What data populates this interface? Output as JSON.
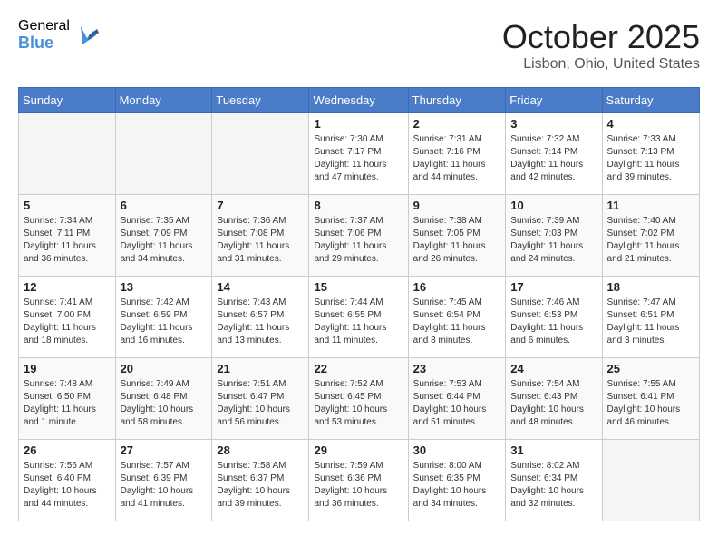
{
  "logo": {
    "general": "General",
    "blue": "Blue"
  },
  "title": "October 2025",
  "location": "Lisbon, Ohio, United States",
  "days_of_week": [
    "Sunday",
    "Monday",
    "Tuesday",
    "Wednesday",
    "Thursday",
    "Friday",
    "Saturday"
  ],
  "weeks": [
    [
      {
        "num": "",
        "info": ""
      },
      {
        "num": "",
        "info": ""
      },
      {
        "num": "",
        "info": ""
      },
      {
        "num": "1",
        "info": "Sunrise: 7:30 AM\nSunset: 7:17 PM\nDaylight: 11 hours\nand 47 minutes."
      },
      {
        "num": "2",
        "info": "Sunrise: 7:31 AM\nSunset: 7:16 PM\nDaylight: 11 hours\nand 44 minutes."
      },
      {
        "num": "3",
        "info": "Sunrise: 7:32 AM\nSunset: 7:14 PM\nDaylight: 11 hours\nand 42 minutes."
      },
      {
        "num": "4",
        "info": "Sunrise: 7:33 AM\nSunset: 7:13 PM\nDaylight: 11 hours\nand 39 minutes."
      }
    ],
    [
      {
        "num": "5",
        "info": "Sunrise: 7:34 AM\nSunset: 7:11 PM\nDaylight: 11 hours\nand 36 minutes."
      },
      {
        "num": "6",
        "info": "Sunrise: 7:35 AM\nSunset: 7:09 PM\nDaylight: 11 hours\nand 34 minutes."
      },
      {
        "num": "7",
        "info": "Sunrise: 7:36 AM\nSunset: 7:08 PM\nDaylight: 11 hours\nand 31 minutes."
      },
      {
        "num": "8",
        "info": "Sunrise: 7:37 AM\nSunset: 7:06 PM\nDaylight: 11 hours\nand 29 minutes."
      },
      {
        "num": "9",
        "info": "Sunrise: 7:38 AM\nSunset: 7:05 PM\nDaylight: 11 hours\nand 26 minutes."
      },
      {
        "num": "10",
        "info": "Sunrise: 7:39 AM\nSunset: 7:03 PM\nDaylight: 11 hours\nand 24 minutes."
      },
      {
        "num": "11",
        "info": "Sunrise: 7:40 AM\nSunset: 7:02 PM\nDaylight: 11 hours\nand 21 minutes."
      }
    ],
    [
      {
        "num": "12",
        "info": "Sunrise: 7:41 AM\nSunset: 7:00 PM\nDaylight: 11 hours\nand 18 minutes."
      },
      {
        "num": "13",
        "info": "Sunrise: 7:42 AM\nSunset: 6:59 PM\nDaylight: 11 hours\nand 16 minutes."
      },
      {
        "num": "14",
        "info": "Sunrise: 7:43 AM\nSunset: 6:57 PM\nDaylight: 11 hours\nand 13 minutes."
      },
      {
        "num": "15",
        "info": "Sunrise: 7:44 AM\nSunset: 6:55 PM\nDaylight: 11 hours\nand 11 minutes."
      },
      {
        "num": "16",
        "info": "Sunrise: 7:45 AM\nSunset: 6:54 PM\nDaylight: 11 hours\nand 8 minutes."
      },
      {
        "num": "17",
        "info": "Sunrise: 7:46 AM\nSunset: 6:53 PM\nDaylight: 11 hours\nand 6 minutes."
      },
      {
        "num": "18",
        "info": "Sunrise: 7:47 AM\nSunset: 6:51 PM\nDaylight: 11 hours\nand 3 minutes."
      }
    ],
    [
      {
        "num": "19",
        "info": "Sunrise: 7:48 AM\nSunset: 6:50 PM\nDaylight: 11 hours\nand 1 minute."
      },
      {
        "num": "20",
        "info": "Sunrise: 7:49 AM\nSunset: 6:48 PM\nDaylight: 10 hours\nand 58 minutes."
      },
      {
        "num": "21",
        "info": "Sunrise: 7:51 AM\nSunset: 6:47 PM\nDaylight: 10 hours\nand 56 minutes."
      },
      {
        "num": "22",
        "info": "Sunrise: 7:52 AM\nSunset: 6:45 PM\nDaylight: 10 hours\nand 53 minutes."
      },
      {
        "num": "23",
        "info": "Sunrise: 7:53 AM\nSunset: 6:44 PM\nDaylight: 10 hours\nand 51 minutes."
      },
      {
        "num": "24",
        "info": "Sunrise: 7:54 AM\nSunset: 6:43 PM\nDaylight: 10 hours\nand 48 minutes."
      },
      {
        "num": "25",
        "info": "Sunrise: 7:55 AM\nSunset: 6:41 PM\nDaylight: 10 hours\nand 46 minutes."
      }
    ],
    [
      {
        "num": "26",
        "info": "Sunrise: 7:56 AM\nSunset: 6:40 PM\nDaylight: 10 hours\nand 44 minutes."
      },
      {
        "num": "27",
        "info": "Sunrise: 7:57 AM\nSunset: 6:39 PM\nDaylight: 10 hours\nand 41 minutes."
      },
      {
        "num": "28",
        "info": "Sunrise: 7:58 AM\nSunset: 6:37 PM\nDaylight: 10 hours\nand 39 minutes."
      },
      {
        "num": "29",
        "info": "Sunrise: 7:59 AM\nSunset: 6:36 PM\nDaylight: 10 hours\nand 36 minutes."
      },
      {
        "num": "30",
        "info": "Sunrise: 8:00 AM\nSunset: 6:35 PM\nDaylight: 10 hours\nand 34 minutes."
      },
      {
        "num": "31",
        "info": "Sunrise: 8:02 AM\nSunset: 6:34 PM\nDaylight: 10 hours\nand 32 minutes."
      },
      {
        "num": "",
        "info": ""
      }
    ]
  ]
}
